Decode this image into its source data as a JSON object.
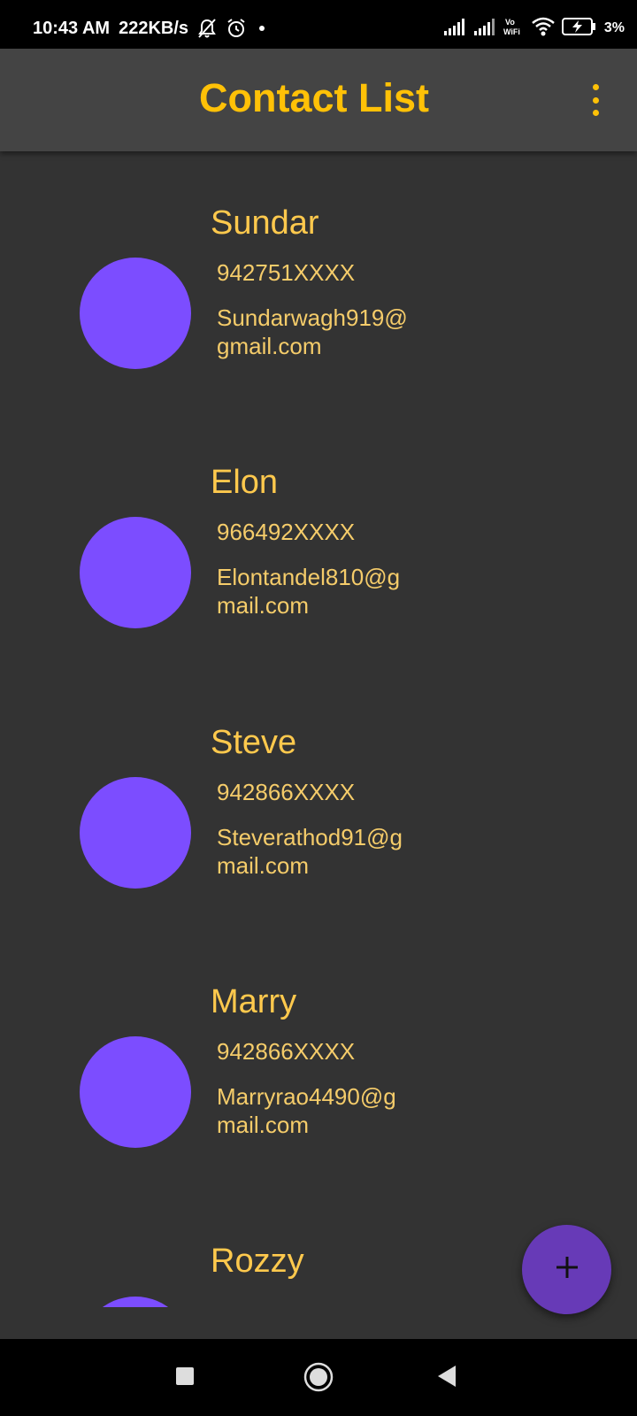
{
  "status_bar": {
    "time": "10:43 AM",
    "speed": "222KB/s",
    "battery": "3%",
    "icons": [
      "notifications-off-icon",
      "alarm-icon",
      "dot-icon",
      "signal-icon",
      "signal-icon",
      "vowifi-icon",
      "wifi-icon",
      "battery-charging-icon"
    ]
  },
  "app_bar": {
    "title": "Contact List",
    "menu_icon": "more-vert-icon"
  },
  "contacts": [
    {
      "name": "Sundar",
      "phone": "942751XXXX",
      "email": "Sundarwagh919@gmail.com"
    },
    {
      "name": "Elon",
      "phone": "966492XXXX",
      "email": "Elontandel810@gmail.com"
    },
    {
      "name": "Steve",
      "phone": "942866XXXX",
      "email": "Steverathod91@gmail.com"
    },
    {
      "name": "Marry",
      "phone": "942866XXXX",
      "email": "Marryrao4490@gmail.com"
    },
    {
      "name": "Rozzy"
    }
  ],
  "fab": {
    "icon": "plus-icon"
  },
  "nav_bar": {
    "icons": [
      "recents-icon",
      "home-icon",
      "back-icon"
    ]
  },
  "colors": {
    "accent": "#FFC107",
    "avatar": "#7C4DFF",
    "fab": "#673AB7",
    "background": "#333333",
    "app_bar": "#444444"
  }
}
